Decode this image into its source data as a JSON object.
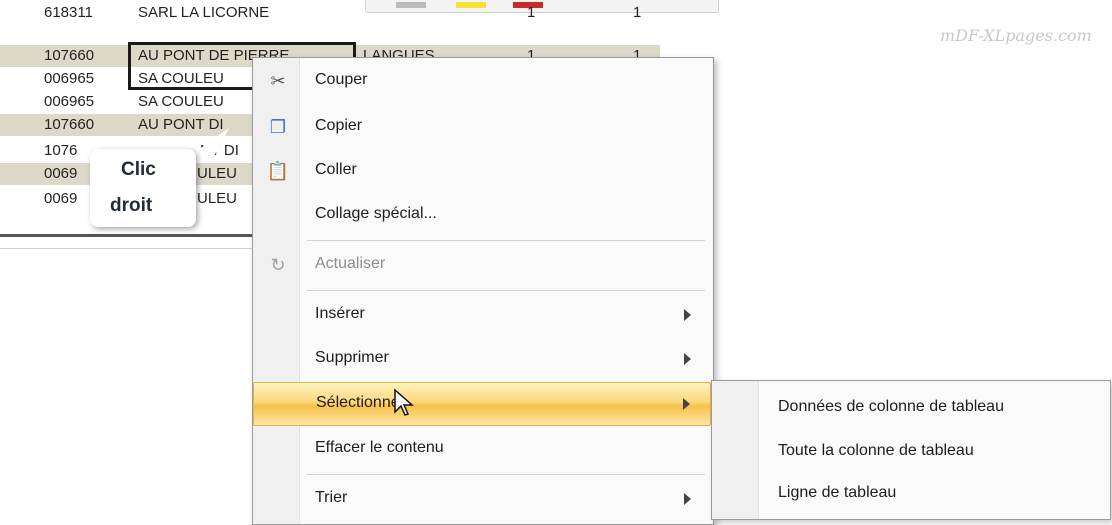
{
  "sheet": {
    "rows": [
      {
        "id": "618311",
        "name": "SARL LA LICORNE",
        "c3": "",
        "c4": "1",
        "c5": "1",
        "shaded": false
      },
      {
        "id": "107660",
        "name": "AU PONT DE PIERRE",
        "c3": "LANGUES",
        "c4": "1",
        "c5": "1",
        "shaded": true
      },
      {
        "id": "006965",
        "name": "SA COULEU",
        "c3": "",
        "c4": "",
        "c5": "",
        "shaded": false
      },
      {
        "id": "006965",
        "name": "SA COULEU",
        "c3": "",
        "c4": "",
        "c5": "",
        "shaded": false
      },
      {
        "id": "107660",
        "name": "AU PONT DI",
        "c3": "",
        "c4": "",
        "c5": "",
        "shaded": true
      },
      {
        "id": "1076",
        "name": "NT DI",
        "c3": "",
        "c4": "",
        "c5": "",
        "shaded": false
      },
      {
        "id": "0069",
        "name": "ULEU",
        "c3": "",
        "c4": "",
        "c5": "",
        "shaded": true
      },
      {
        "id": "0069",
        "name": "ULEU",
        "c3": "",
        "c4": "",
        "c5": "",
        "shaded": false
      }
    ]
  },
  "watermark": "mDF-XLpages.com",
  "callout": {
    "line1": "Clic",
    "line2": "droit"
  },
  "context_menu": {
    "items": [
      {
        "label": "Couper",
        "icon": "scissors-icon",
        "glyph": "✂",
        "disabled": false,
        "submenu": false
      },
      {
        "label": "Copier",
        "icon": "copy-icon",
        "glyph": "❐",
        "disabled": false,
        "submenu": false
      },
      {
        "label": "Coller",
        "icon": "paste-icon",
        "glyph": "📋",
        "disabled": false,
        "submenu": false
      },
      {
        "label": "Collage spécial...",
        "icon": "",
        "glyph": "",
        "disabled": false,
        "submenu": false
      },
      {
        "label": "Actualiser",
        "icon": "refresh-icon",
        "glyph": "↻",
        "disabled": true,
        "submenu": false
      },
      {
        "label": "Insérer",
        "icon": "",
        "glyph": "",
        "disabled": false,
        "submenu": true
      },
      {
        "label": "Supprimer",
        "icon": "",
        "glyph": "",
        "disabled": false,
        "submenu": true
      },
      {
        "label": "Sélectionner",
        "icon": "",
        "glyph": "",
        "disabled": false,
        "submenu": true,
        "highlight": true
      },
      {
        "label": "Effacer le contenu",
        "icon": "",
        "glyph": "",
        "disabled": false,
        "submenu": false
      },
      {
        "label": "Trier",
        "icon": "",
        "glyph": "",
        "disabled": false,
        "submenu": true
      }
    ]
  },
  "submenu": {
    "items": [
      {
        "label": "Données de colonne de tableau"
      },
      {
        "label": "Toute la colonne de tableau"
      },
      {
        "label": "Ligne de tableau"
      }
    ]
  },
  "colors": {
    "highlight": "#f7c24a",
    "row_shade": "#ddd9c8"
  }
}
